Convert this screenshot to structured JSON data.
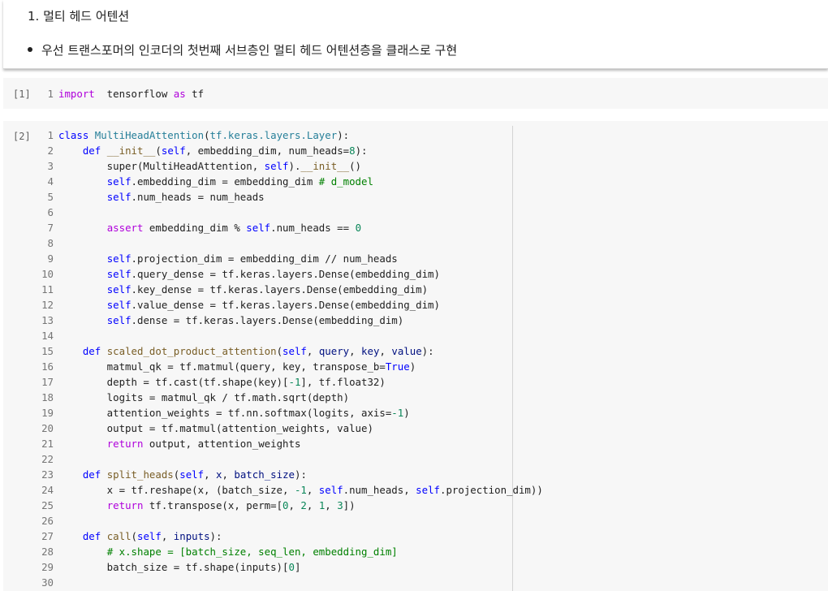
{
  "markdown": {
    "heading": "1. 멀티 헤드 어텐션",
    "bullet": "우선 트랜스포머의 인코더의 첫번째 서브층인 멀티 헤드 어텐션층을 클래스로 구현"
  },
  "cells": [
    {
      "exec_count": "[1]",
      "lines": [
        {
          "n": "1",
          "tokens": [
            [
              "kw",
              "import"
            ],
            [
              "",
              "  tensorflow "
            ],
            [
              "kw",
              "as"
            ],
            [
              "",
              " tf"
            ]
          ]
        }
      ]
    },
    {
      "exec_count": "[2]",
      "lines": [
        {
          "n": "1",
          "tokens": [
            [
              "def",
              "class"
            ],
            [
              "",
              " "
            ],
            [
              "cls",
              "MultiHeadAttention"
            ],
            [
              "",
              "("
            ],
            [
              "cls",
              "tf.keras.layers.Layer"
            ],
            [
              "",
              "):"
            ]
          ]
        },
        {
          "n": "2",
          "tokens": [
            [
              "",
              "    "
            ],
            [
              "def",
              "def"
            ],
            [
              "",
              " "
            ],
            [
              "fn",
              "__init__"
            ],
            [
              "",
              "("
            ],
            [
              "self",
              "self"
            ],
            [
              "",
              ", embedding_dim, num_heads="
            ],
            [
              "num",
              "8"
            ],
            [
              "",
              "):"
            ]
          ]
        },
        {
          "n": "3",
          "tokens": [
            [
              "",
              "        super(MultiHeadAttention, "
            ],
            [
              "self",
              "self"
            ],
            [
              "",
              ")."
            ],
            [
              "fn",
              "__init__"
            ],
            [
              "",
              "()"
            ]
          ]
        },
        {
          "n": "4",
          "tokens": [
            [
              "",
              "        "
            ],
            [
              "self",
              "self"
            ],
            [
              "",
              ".embedding_dim = embedding_dim "
            ],
            [
              "cm",
              "# d_model"
            ]
          ]
        },
        {
          "n": "5",
          "tokens": [
            [
              "",
              "        "
            ],
            [
              "self",
              "self"
            ],
            [
              "",
              ".num_heads = num_heads"
            ]
          ]
        },
        {
          "n": "6",
          "tokens": [
            [
              "",
              ""
            ]
          ]
        },
        {
          "n": "7",
          "tokens": [
            [
              "",
              "        "
            ],
            [
              "kw",
              "assert"
            ],
            [
              "",
              " embedding_dim % "
            ],
            [
              "self",
              "self"
            ],
            [
              "",
              ".num_heads == "
            ],
            [
              "num",
              "0"
            ]
          ]
        },
        {
          "n": "8",
          "tokens": [
            [
              "",
              ""
            ]
          ]
        },
        {
          "n": "9",
          "tokens": [
            [
              "",
              "        "
            ],
            [
              "self",
              "self"
            ],
            [
              "",
              ".projection_dim = embedding_dim // num_heads"
            ]
          ]
        },
        {
          "n": "10",
          "tokens": [
            [
              "",
              "        "
            ],
            [
              "self",
              "self"
            ],
            [
              "",
              ".query_dense = tf.keras.layers.Dense(embedding_dim)"
            ]
          ]
        },
        {
          "n": "11",
          "tokens": [
            [
              "",
              "        "
            ],
            [
              "self",
              "self"
            ],
            [
              "",
              ".key_dense = tf.keras.layers.Dense(embedding_dim)"
            ]
          ]
        },
        {
          "n": "12",
          "tokens": [
            [
              "",
              "        "
            ],
            [
              "self",
              "self"
            ],
            [
              "",
              ".value_dense = tf.keras.layers.Dense(embedding_dim)"
            ]
          ]
        },
        {
          "n": "13",
          "tokens": [
            [
              "",
              "        "
            ],
            [
              "self",
              "self"
            ],
            [
              "",
              ".dense = tf.keras.layers.Dense(embedding_dim)"
            ]
          ]
        },
        {
          "n": "14",
          "tokens": [
            [
              "",
              ""
            ]
          ]
        },
        {
          "n": "15",
          "tokens": [
            [
              "",
              "    "
            ],
            [
              "def",
              "def"
            ],
            [
              "",
              " "
            ],
            [
              "fn",
              "scaled_dot_product_attention"
            ],
            [
              "",
              "("
            ],
            [
              "self",
              "self"
            ],
            [
              "",
              ", "
            ],
            [
              "param",
              "query"
            ],
            [
              "",
              ", "
            ],
            [
              "param",
              "key"
            ],
            [
              "",
              ", "
            ],
            [
              "param",
              "value"
            ],
            [
              "",
              "):"
            ]
          ]
        },
        {
          "n": "16",
          "tokens": [
            [
              "",
              "        matmul_qk = tf.matmul(query, key, transpose_b="
            ],
            [
              "def",
              "True"
            ],
            [
              "",
              ")"
            ]
          ]
        },
        {
          "n": "17",
          "tokens": [
            [
              "",
              "        depth = tf.cast(tf.shape(key)["
            ],
            [
              "num",
              "-1"
            ],
            [
              "",
              "], tf.float32)"
            ]
          ]
        },
        {
          "n": "18",
          "tokens": [
            [
              "",
              "        logits = matmul_qk / tf.math.sqrt(depth)"
            ]
          ]
        },
        {
          "n": "19",
          "tokens": [
            [
              "",
              "        attention_weights = tf.nn.softmax(logits, axis="
            ],
            [
              "num",
              "-1"
            ],
            [
              "",
              ")"
            ]
          ]
        },
        {
          "n": "20",
          "tokens": [
            [
              "",
              "        output = tf.matmul(attention_weights, value)"
            ]
          ]
        },
        {
          "n": "21",
          "tokens": [
            [
              "",
              "        "
            ],
            [
              "kw",
              "return"
            ],
            [
              "",
              " output, attention_weights"
            ]
          ]
        },
        {
          "n": "22",
          "tokens": [
            [
              "",
              ""
            ]
          ]
        },
        {
          "n": "23",
          "tokens": [
            [
              "",
              "    "
            ],
            [
              "def",
              "def"
            ],
            [
              "",
              " "
            ],
            [
              "fn",
              "split_heads"
            ],
            [
              "",
              "("
            ],
            [
              "self",
              "self"
            ],
            [
              "",
              ", "
            ],
            [
              "param",
              "x"
            ],
            [
              "",
              ", "
            ],
            [
              "param",
              "batch_size"
            ],
            [
              "",
              "):"
            ]
          ]
        },
        {
          "n": "24",
          "tokens": [
            [
              "",
              "        x = tf.reshape(x, (batch_size, "
            ],
            [
              "num",
              "-1"
            ],
            [
              "",
              ", "
            ],
            [
              "self",
              "self"
            ],
            [
              "",
              ".num_heads, "
            ],
            [
              "self",
              "self"
            ],
            [
              "",
              ".projection_dim))"
            ]
          ]
        },
        {
          "n": "25",
          "tokens": [
            [
              "",
              "        "
            ],
            [
              "kw",
              "return"
            ],
            [
              "",
              " tf.transpose(x, perm=["
            ],
            [
              "num",
              "0"
            ],
            [
              "",
              ", "
            ],
            [
              "num",
              "2"
            ],
            [
              "",
              ", "
            ],
            [
              "num",
              "1"
            ],
            [
              "",
              ", "
            ],
            [
              "num",
              "3"
            ],
            [
              "",
              "])"
            ]
          ]
        },
        {
          "n": "26",
          "tokens": [
            [
              "",
              ""
            ]
          ]
        },
        {
          "n": "27",
          "tokens": [
            [
              "",
              "    "
            ],
            [
              "def",
              "def"
            ],
            [
              "",
              " "
            ],
            [
              "fn",
              "call"
            ],
            [
              "",
              "("
            ],
            [
              "self",
              "self"
            ],
            [
              "",
              ", "
            ],
            [
              "param",
              "inputs"
            ],
            [
              "",
              "):"
            ]
          ]
        },
        {
          "n": "28",
          "tokens": [
            [
              "",
              "        "
            ],
            [
              "cm",
              "# x.shape = [batch_size, seq_len, embedding_dim]"
            ]
          ]
        },
        {
          "n": "29",
          "tokens": [
            [
              "",
              "        batch_size = tf.shape(inputs)["
            ],
            [
              "num",
              "0"
            ],
            [
              "",
              "]"
            ]
          ]
        },
        {
          "n": "30",
          "tokens": [
            [
              "",
              ""
            ]
          ]
        }
      ]
    }
  ]
}
